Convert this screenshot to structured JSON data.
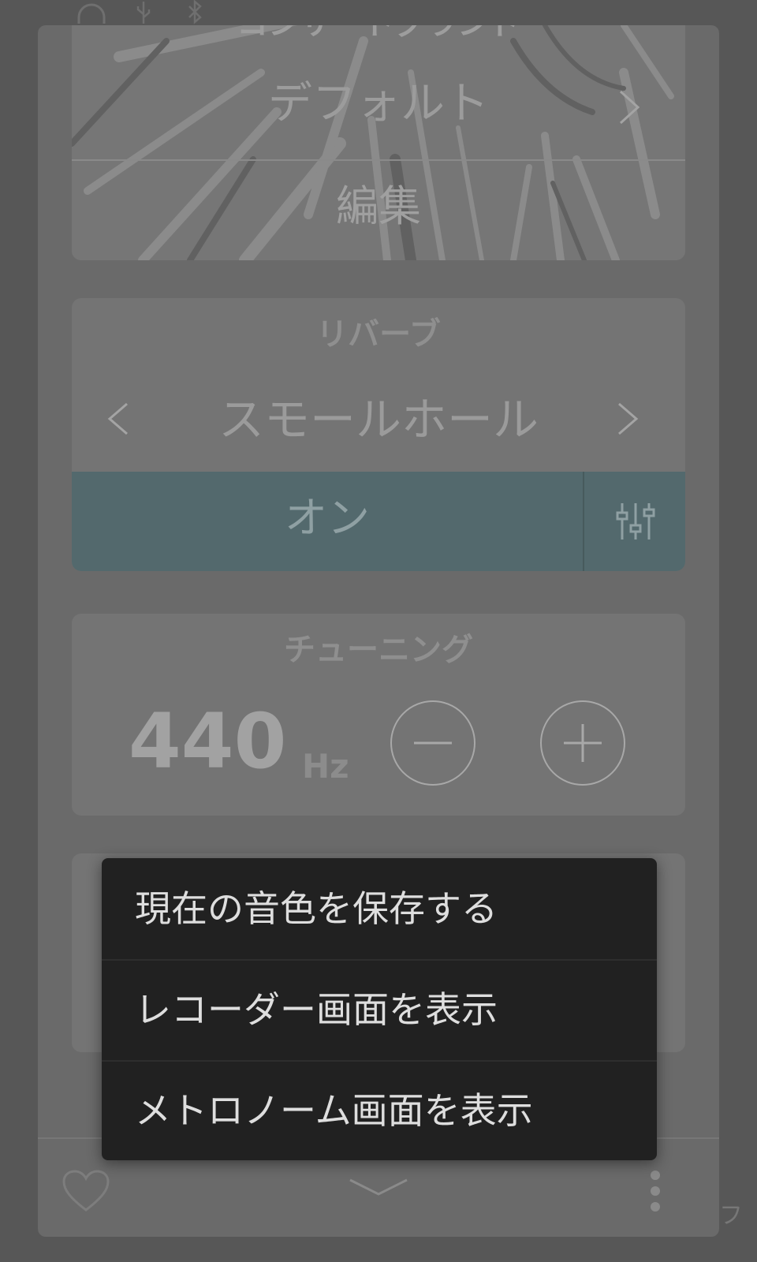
{
  "status_bar": {
    "icons": [
      "headphones-icon",
      "usb-icon",
      "bluetooth-icon"
    ]
  },
  "preset": {
    "cut_title": "コンサートグランド",
    "name": "デフォルト",
    "edit_label": "編集"
  },
  "reverb": {
    "title": "リバーブ",
    "type": "スモールホール",
    "toggle_label": "オン"
  },
  "tuning": {
    "title": "チューニング",
    "value": "440",
    "unit": "Hz"
  },
  "bottom_bar": {
    "icons": [
      "heart-icon",
      "chevron-down-icon",
      "more-vertical-icon"
    ],
    "edge_text": "フ"
  },
  "popup_menu": {
    "items": [
      {
        "label": "現在の音色を保存する"
      },
      {
        "label": "レコーダー画面を表示"
      },
      {
        "label": "メトロノーム画面を表示"
      }
    ]
  },
  "colors": {
    "toggle_on": "#53696d",
    "menu_bg": "#212121",
    "panel_bg": "#6a6a6a"
  }
}
